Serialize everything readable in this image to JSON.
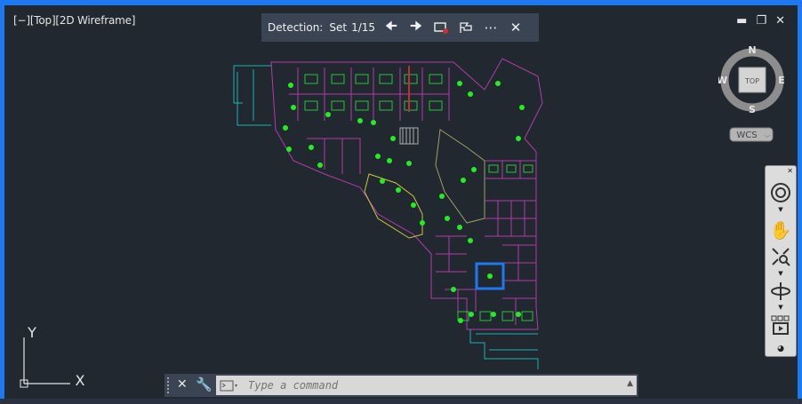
{
  "viewport": {
    "label": "[−][Top][2D Wireframe]",
    "border_color": "#1e78f0"
  },
  "detection": {
    "label": "Detection:",
    "set_label": "Set",
    "counter": "1/15",
    "icons": [
      "arrow-left-icon",
      "arrow-right-icon",
      "markup-icon",
      "flag-icon",
      "more-icon",
      "close-icon"
    ]
  },
  "window_controls": [
    "minimize-icon",
    "restore-icon",
    "close-icon"
  ],
  "viewcube": {
    "face": "TOP",
    "north": "N",
    "south": "S",
    "east": "E",
    "west": "W",
    "coord_system": "WCS"
  },
  "ucs": {
    "x_label": "X",
    "y_label": "Y"
  },
  "navbar": {
    "tools": [
      "steering-wheel-icon",
      "pan-icon",
      "zoom-extents-icon",
      "orbit-icon",
      "showmotion-icon"
    ]
  },
  "command": {
    "placeholder": "Type a command"
  },
  "colors": {
    "background": "#212830",
    "walls_magenta": "#b23ca8",
    "walls_cyan": "#1fb2b2",
    "walls_yellow": "#c8c83c",
    "furniture_green": "#2fbf3f",
    "markers_green": "#22ee22",
    "highlight_blue": "#1e78f0"
  }
}
